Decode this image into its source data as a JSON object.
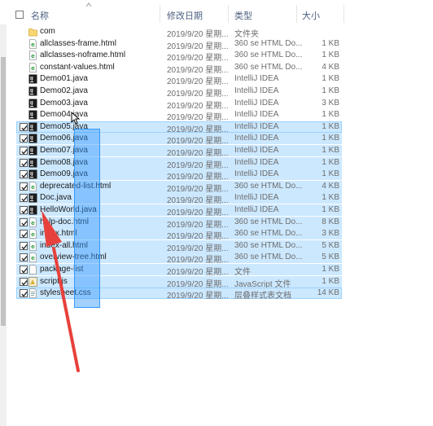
{
  "header": {
    "name": "名称",
    "date": "修改日期",
    "type": "类型",
    "size": "大小"
  },
  "files": [
    {
      "name": "com",
      "date": "2019/9/20 星期...",
      "type": "文件夹",
      "size": "",
      "icon": "folder",
      "selected": false
    },
    {
      "name": "allclasses-frame.html",
      "date": "2019/9/20 星期...",
      "type": "360 se HTML Do...",
      "size": "1 KB",
      "icon": "html",
      "selected": false
    },
    {
      "name": "allclasses-noframe.html",
      "date": "2019/9/20 星期...",
      "type": "360 se HTML Do...",
      "size": "1 KB",
      "icon": "html",
      "selected": false
    },
    {
      "name": "constant-values.html",
      "date": "2019/9/20 星期...",
      "type": "360 se HTML Do...",
      "size": "4 KB",
      "icon": "html",
      "selected": false
    },
    {
      "name": "Demo01.java",
      "date": "2019/9/20 星期...",
      "type": "IntelliJ IDEA",
      "size": "1 KB",
      "icon": "java",
      "selected": false
    },
    {
      "name": "Demo02.java",
      "date": "2019/9/20 星期...",
      "type": "IntelliJ IDEA",
      "size": "1 KB",
      "icon": "java",
      "selected": false
    },
    {
      "name": "Demo03.java",
      "date": "2019/9/20 星期...",
      "type": "IntelliJ IDEA",
      "size": "3 KB",
      "icon": "java",
      "selected": false
    },
    {
      "name": "Demo04.java",
      "date": "2019/9/20 星期...",
      "type": "IntelliJ IDEA",
      "size": "1 KB",
      "icon": "java",
      "selected": false
    },
    {
      "name": "Demo05.java",
      "date": "2019/9/20 星期...",
      "type": "IntelliJ IDEA",
      "size": "1 KB",
      "icon": "java",
      "selected": true
    },
    {
      "name": "Demo06.java",
      "date": "2019/9/20 星期...",
      "type": "IntelliJ IDEA",
      "size": "1 KB",
      "icon": "java",
      "selected": true
    },
    {
      "name": "Demo07.java",
      "date": "2019/9/20 星期...",
      "type": "IntelliJ IDEA",
      "size": "1 KB",
      "icon": "java",
      "selected": true
    },
    {
      "name": "Demo08.java",
      "date": "2019/9/20 星期...",
      "type": "IntelliJ IDEA",
      "size": "1 KB",
      "icon": "java",
      "selected": true
    },
    {
      "name": "Demo09.java",
      "date": "2019/9/20 星期...",
      "type": "IntelliJ IDEA",
      "size": "1 KB",
      "icon": "java",
      "selected": true
    },
    {
      "name": "deprecated-list.html",
      "date": "2019/9/20 星期...",
      "type": "360 se HTML Do...",
      "size": "4 KB",
      "icon": "html",
      "selected": true
    },
    {
      "name": "Doc.java",
      "date": "2019/9/20 星期...",
      "type": "IntelliJ IDEA",
      "size": "1 KB",
      "icon": "java",
      "selected": true
    },
    {
      "name": "HelloWorld.java",
      "date": "2019/9/20 星期...",
      "type": "IntelliJ IDEA",
      "size": "1 KB",
      "icon": "java",
      "selected": true
    },
    {
      "name": "help-doc.html",
      "date": "2019/9/20 星期...",
      "type": "360 se HTML Do...",
      "size": "8 KB",
      "icon": "html",
      "selected": true
    },
    {
      "name": "index.html",
      "date": "2019/9/20 星期...",
      "type": "360 se HTML Do...",
      "size": "3 KB",
      "icon": "html",
      "selected": true
    },
    {
      "name": "index-all.html",
      "date": "2019/9/20 星期...",
      "type": "360 se HTML Do...",
      "size": "5 KB",
      "icon": "html",
      "selected": true
    },
    {
      "name": "overview-tree.html",
      "date": "2019/9/20 星期...",
      "type": "360 se HTML Do...",
      "size": "5 KB",
      "icon": "html",
      "selected": true
    },
    {
      "name": "package-list",
      "date": "2019/9/20 星期...",
      "type": "文件",
      "size": "1 KB",
      "icon": "file",
      "selected": true
    },
    {
      "name": "script.js",
      "date": "2019/9/20 星期...",
      "type": "JavaScript 文件",
      "size": "1 KB",
      "icon": "js",
      "selected": true
    },
    {
      "name": "stylesheet.css",
      "date": "2019/9/20 星期...",
      "type": "层叠样式表文档",
      "size": "14 KB",
      "icon": "css",
      "selected": true
    }
  ],
  "colors": {
    "selection": "#cce8ff",
    "selection_border": "#99d1ff",
    "drag": "#3399ff",
    "arrow": "#e8413c"
  }
}
